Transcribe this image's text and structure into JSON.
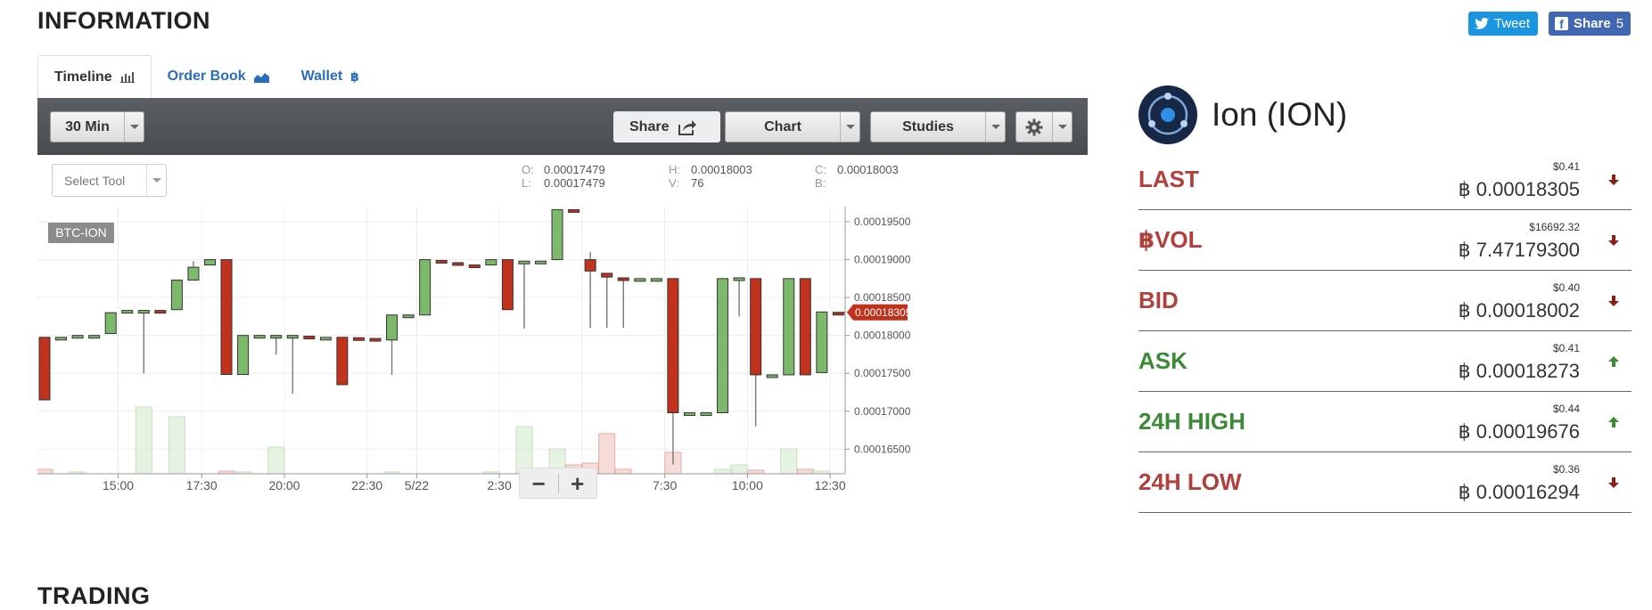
{
  "page": {
    "information_title": "INFORMATION",
    "trading_title": "TRADING"
  },
  "social": {
    "tweet_label": "Tweet",
    "share_label": "Share",
    "share_count": "5"
  },
  "tabs": [
    {
      "label": "Timeline",
      "icon": "bar-chart-icon",
      "active": true
    },
    {
      "label": "Order Book",
      "icon": "area-chart-icon",
      "active": false
    },
    {
      "label": "Wallet",
      "icon": "bitcoin-icon",
      "active": false
    }
  ],
  "toolbar": {
    "interval": "30 Min",
    "share": "Share",
    "chart": "Chart",
    "studies": "Studies"
  },
  "select_tool": {
    "placeholder": "Select Tool"
  },
  "ohlc": {
    "o_label": "O:",
    "o": "0.00017479",
    "l_label": "L:",
    "l": "0.00017479",
    "h_label": "H:",
    "h": "0.00018003",
    "v_label": "V:",
    "v": "76",
    "c_label": "C:",
    "c": "0.00018003",
    "b_label": "B:",
    "b": ""
  },
  "chart_data": {
    "type": "candlestick",
    "symbol": "BTC-ION",
    "current_price": "0.00018305",
    "y_ticks": [
      "0.00019500",
      "0.00019000",
      "0.00018500",
      "0.00018000",
      "0.00017500",
      "0.00017000",
      "0.00016500"
    ],
    "ylim": [
      0.00016175,
      0.000197
    ],
    "x_ticks": [
      "15:00",
      "17:30",
      "20:00",
      "22:30",
      "5/22",
      "2:30",
      "5:00",
      "7:30",
      "10:00",
      "12:30"
    ],
    "x_tick_index": [
      4.45,
      9.5,
      14.5,
      19.5,
      22.5,
      27.5,
      32.5,
      37.5,
      42.5,
      47.5
    ],
    "up_color": "#7cb96a",
    "down_color": "#c0321c",
    "candles": [
      {
        "o": 0.00017975,
        "h": 0.00017975,
        "l": 0.0001715,
        "c": 0.0001715
      },
      {
        "o": 0.00017975,
        "h": 0.00017975,
        "l": 0.00017975,
        "c": 0.00017975
      },
      {
        "o": 0.00017975,
        "h": 0.00018,
        "l": 0.00017975,
        "c": 0.00018
      },
      {
        "o": 0.00018,
        "h": 0.00018,
        "l": 0.00018,
        "c": 0.00018
      },
      {
        "o": 0.00018025,
        "h": 0.000183,
        "l": 0.00018025,
        "c": 0.000183
      },
      {
        "o": 0.0001833,
        "h": 0.0001833,
        "l": 0.0001833,
        "c": 0.0001833
      },
      {
        "o": 0.0001833,
        "h": 0.0001833,
        "l": 0.000175,
        "c": 0.0001833
      },
      {
        "o": 0.0001833,
        "h": 0.0001833,
        "l": 0.0001831,
        "c": 0.0001831
      },
      {
        "o": 0.0001834,
        "h": 0.0001873,
        "l": 0.0001834,
        "c": 0.0001873
      },
      {
        "o": 0.0001873,
        "h": 0.0001898,
        "l": 0.0001873,
        "c": 0.000189
      },
      {
        "o": 0.0001893,
        "h": 0.00019,
        "l": 0.0001893,
        "c": 0.00019
      },
      {
        "o": 0.00019,
        "h": 0.00019,
        "l": 0.00017485,
        "c": 0.00017485
      },
      {
        "o": 0.00017485,
        "h": 0.00018,
        "l": 0.00017485,
        "c": 0.00018
      },
      {
        "o": 0.00018,
        "h": 0.00018,
        "l": 0.00018,
        "c": 0.00018
      },
      {
        "o": 0.00018,
        "h": 0.00018,
        "l": 0.0001775,
        "c": 0.00018
      },
      {
        "o": 0.00018,
        "h": 0.00018,
        "l": 0.0001723,
        "c": 0.00018
      },
      {
        "o": 0.0001799,
        "h": 0.0001799,
        "l": 0.0001797,
        "c": 0.0001797
      },
      {
        "o": 0.00017975,
        "h": 0.00017975,
        "l": 0.00017975,
        "c": 0.00017975
      },
      {
        "o": 0.00017975,
        "h": 0.00017975,
        "l": 0.0001735,
        "c": 0.0001735
      },
      {
        "o": 0.0001797,
        "h": 0.0001797,
        "l": 0.0001795,
        "c": 0.0001795
      },
      {
        "o": 0.0001796,
        "h": 0.0001796,
        "l": 0.0001793,
        "c": 0.0001793
      },
      {
        "o": 0.0001794,
        "h": 0.0001827,
        "l": 0.0001748,
        "c": 0.0001827
      },
      {
        "o": 0.0001827,
        "h": 0.0001827,
        "l": 0.0001827,
        "c": 0.0001827
      },
      {
        "o": 0.0001827,
        "h": 0.00019,
        "l": 0.0001827,
        "c": 0.00019
      },
      {
        "o": 0.0001899,
        "h": 0.0001899,
        "l": 0.0001897,
        "c": 0.0001897
      },
      {
        "o": 0.0001896,
        "h": 0.0001896,
        "l": 0.0001894,
        "c": 0.0001894
      },
      {
        "o": 0.0001893,
        "h": 0.0001893,
        "l": 0.0001891,
        "c": 0.0001891
      },
      {
        "o": 0.0001893,
        "h": 0.00019,
        "l": 0.0001893,
        "c": 0.00019
      },
      {
        "o": 0.00019,
        "h": 0.00019,
        "l": 0.0001834,
        "c": 0.0001834
      },
      {
        "o": 0.0001898,
        "h": 0.0001898,
        "l": 0.0001809,
        "c": 0.0001898
      },
      {
        "o": 0.0001898,
        "h": 0.0001898,
        "l": 0.0001898,
        "c": 0.0001898
      },
      {
        "o": 0.00019,
        "h": 0.0001966,
        "l": 0.00019,
        "c": 0.0001966
      },
      {
        "o": 0.0001966,
        "h": 0.0001966,
        "l": 0.0001964,
        "c": 0.0001964
      },
      {
        "o": 0.00019,
        "h": 0.000191,
        "l": 0.000181,
        "c": 0.0001885
      },
      {
        "o": 0.0001882,
        "h": 0.0001882,
        "l": 0.000181,
        "c": 0.0001877
      },
      {
        "o": 0.0001876,
        "h": 0.0001876,
        "l": 0.000181,
        "c": 0.0001874
      },
      {
        "o": 0.0001875,
        "h": 0.0001875,
        "l": 0.0001875,
        "c": 0.0001875
      },
      {
        "o": 0.0001875,
        "h": 0.0001875,
        "l": 0.0001875,
        "c": 0.0001875
      },
      {
        "o": 0.0001875,
        "h": 0.0001875,
        "l": 0.000163,
        "c": 0.0001698
      },
      {
        "o": 0.0001698,
        "h": 0.0001698,
        "l": 0.0001698,
        "c": 0.0001698
      },
      {
        "o": 0.0001698,
        "h": 0.0001698,
        "l": 0.0001698,
        "c": 0.0001698
      },
      {
        "o": 0.0001698,
        "h": 0.0001875,
        "l": 0.0001698,
        "c": 0.0001875
      },
      {
        "o": 0.0001873,
        "h": 0.0001876,
        "l": 0.0001825,
        "c": 0.0001876
      },
      {
        "o": 0.0001875,
        "h": 0.0001875,
        "l": 0.000168,
        "c": 0.0001748
      },
      {
        "o": 0.0001748,
        "h": 0.0001748,
        "l": 0.0001748,
        "c": 0.0001748
      },
      {
        "o": 0.0001748,
        "h": 0.0001875,
        "l": 0.0001748,
        "c": 0.0001875
      },
      {
        "o": 0.0001875,
        "h": 0.0001875,
        "l": 0.0001748,
        "c": 0.0001748
      },
      {
        "o": 0.0001751,
        "h": 0.0001831,
        "l": 0.0001751,
        "c": 0.0001831
      },
      {
        "o": 0.00018305,
        "h": 0.00018305,
        "l": 0.0001829,
        "c": 0.0001829
      }
    ],
    "volumes": [
      5,
      0,
      2,
      0,
      0,
      0,
      75,
      0,
      64,
      0,
      0,
      3,
      2,
      0,
      30,
      0,
      0,
      0,
      0,
      0,
      0,
      2,
      0,
      0,
      0,
      0,
      0,
      2,
      0,
      53,
      0,
      28,
      10,
      12,
      45,
      5,
      0,
      0,
      24,
      0,
      0,
      5,
      10,
      4,
      0,
      28,
      5,
      3,
      0
    ]
  },
  "coin": {
    "name": "Ion (ION)",
    "icon": "ion-coin-logo"
  },
  "stats": [
    {
      "label": "LAST",
      "usd": "$0.41",
      "btc": "0.00018305",
      "trend": "down",
      "color": "#b0403c"
    },
    {
      "label": "฿VOL",
      "usd": "$16692.32",
      "btc": "7.47179300",
      "trend": "down",
      "color": "#b0403c"
    },
    {
      "label": "BID",
      "usd": "$0.40",
      "btc": "0.00018002",
      "trend": "down",
      "color": "#b0403c"
    },
    {
      "label": "ASK",
      "usd": "$0.41",
      "btc": "0.00018273",
      "trend": "up",
      "color": "#3c8a37"
    },
    {
      "label": "24H HIGH",
      "usd": "$0.44",
      "btc": "0.00019676",
      "trend": "up",
      "color": "#3c8a37"
    },
    {
      "label": "24H LOW",
      "usd": "$0.36",
      "btc": "0.00016294",
      "trend": "down",
      "color": "#b0403c"
    }
  ],
  "currency_symbol": "฿"
}
